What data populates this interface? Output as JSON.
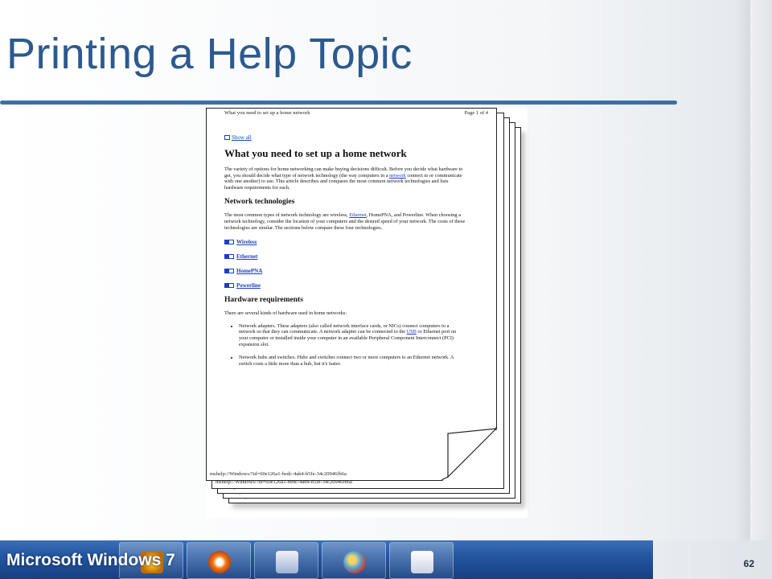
{
  "slide": {
    "title": "Printing a Help Topic",
    "footer_label": "Microsoft Windows 7",
    "slide_number": "62"
  },
  "document": {
    "header_left": "What you need to set up a home network",
    "header_right": "Page 1 of 4",
    "show_all": "Show all",
    "heading": "What you need to set up a home network",
    "intro_1": "The variety of options for home networking can make buying decisions difficult. Before you decide what hardware to get, you should decide what type of network technology (the way computers in a ",
    "intro_link": "network",
    "intro_2": " connect to or communicate with one another) to use. This article describes and compares the most common network technologies and lists hardware requirements for each.",
    "section1_heading": "Network technologies",
    "tech_1": "The most common types of network technology are wireless, ",
    "tech_link": "Ethernet",
    "tech_2": ", HomePNA, and Powerline. When choosing a network technology, consider the location of your computers and the desired speed of your network. The costs of these technologies are similar. The sections below compare these four technologies.",
    "expanders": [
      "Wireless",
      "Ethernet",
      "HomePNA",
      "Powerline"
    ],
    "section2_heading": "Hardware requirements",
    "hw_intro": "There are several kinds of hardware used in home networks:",
    "bullet1_a": "Network adapters. These adapters (also called network interface cards, or NICs) connect computers to a network so that they can communicate. A network adapter can be connected to the ",
    "bullet1_link": "USB",
    "bullet1_b": " or Ethernet port on your computer or installed inside your computer in an available Peripheral Component Interconnect (PCI) expansion slot.",
    "bullet2": "Network hubs and switches. Hubs and switches connect two or more computers to an Ethernet network. A switch costs a little more than a hub, but it's faster.",
    "footer_url": "mshelp://Windows/?id=60e126a1-bedc-4ab4-b5fe-34c20946fb6a"
  },
  "colors": {
    "title": "#2c5a8f",
    "rule": "#3b6fa8",
    "link": "#1a3fbf",
    "taskbar": "#2456a0"
  }
}
